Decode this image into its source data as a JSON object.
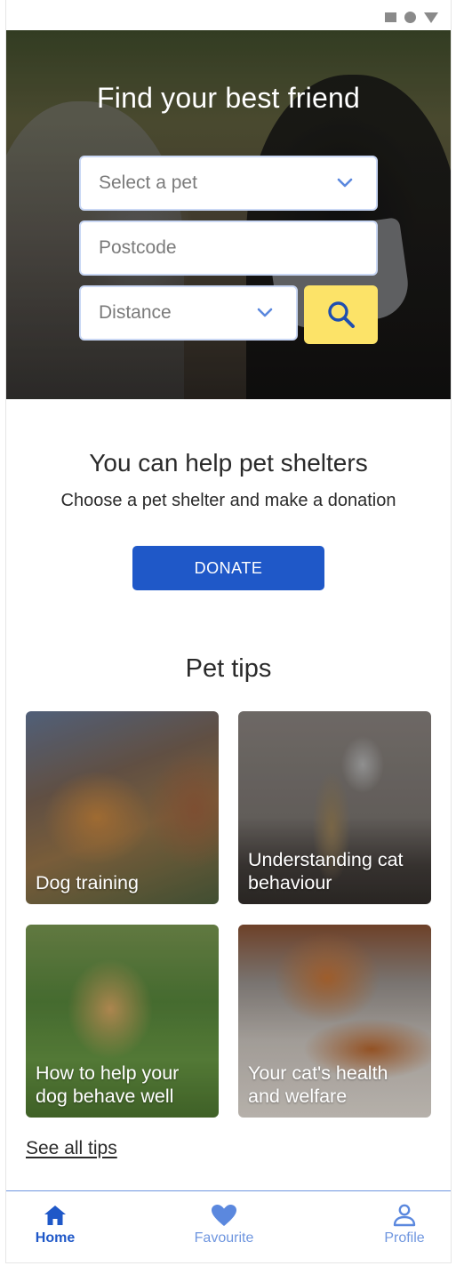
{
  "hero": {
    "title": "Find your best friend",
    "pet_select": "Select a pet",
    "postcode_placeholder": "Postcode",
    "distance_select": "Distance"
  },
  "donation": {
    "title": "You can help pet shelters",
    "subtitle": "Choose a pet shelter and make a donation",
    "button_label": "DONATE"
  },
  "tips": {
    "title": "Pet tips",
    "cards": [
      {
        "label": "Dog training"
      },
      {
        "label": "Understanding cat behaviour"
      },
      {
        "label": "How to help your dog behave well"
      },
      {
        "label": "Your cat's health and welfare"
      }
    ],
    "see_all": "See all tips"
  },
  "nav": {
    "items": [
      {
        "label": "Home",
        "icon": "home-icon",
        "active": true
      },
      {
        "label": "Favourite",
        "icon": "heart-icon",
        "active": false
      },
      {
        "label": "Profile",
        "icon": "person-icon",
        "active": false
      }
    ]
  },
  "colors": {
    "primary": "#1f58c8",
    "accent_yellow": "#fce368",
    "nav_inactive": "#6f96df"
  }
}
